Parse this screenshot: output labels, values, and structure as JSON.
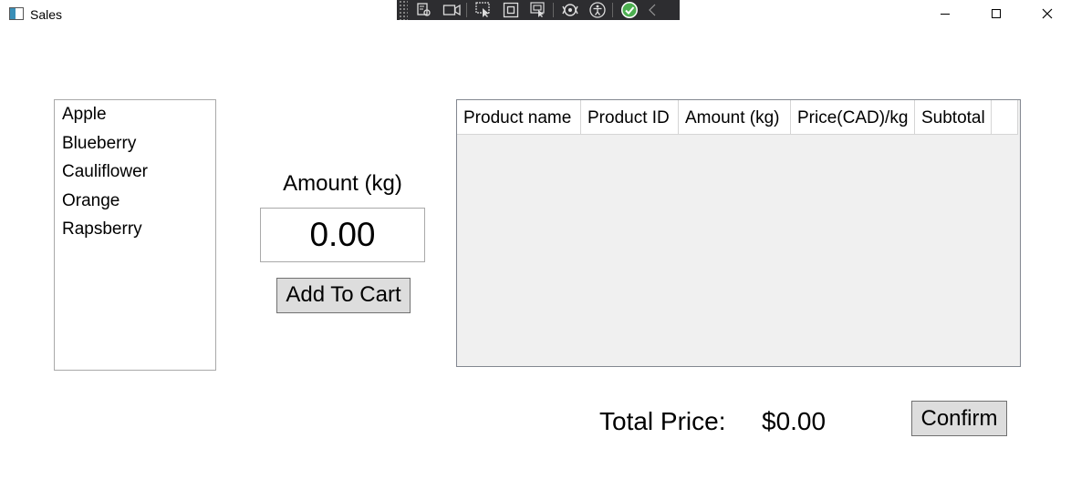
{
  "window": {
    "title": "Sales",
    "icons": [
      "app-window-icon",
      "minimize-icon",
      "maximize-icon",
      "close-icon"
    ]
  },
  "debug_toolbar": {
    "icons": [
      "live-visual-tree-icon",
      "record-icon",
      "select-element-icon",
      "display-layout-adorners-icon",
      "track-focus-icon",
      "hot-reload-icon",
      "accessibility-icon",
      "check-icon",
      "collapse-chevron-icon"
    ],
    "check_color": "#4caf50"
  },
  "products": {
    "items": [
      "Apple",
      "Blueberry",
      "Cauliflower",
      "Orange",
      "Rapsberry"
    ]
  },
  "amount": {
    "label": "Amount (kg)",
    "value": "0.00"
  },
  "add_button": {
    "label": "Add To Cart"
  },
  "cart": {
    "columns": [
      "Product name",
      "Product ID",
      "Amount (kg)",
      "Price(CAD)/kg",
      "Subtotal"
    ],
    "rows": []
  },
  "total": {
    "label": "Total Price:",
    "value": "$0.00"
  },
  "confirm_button": {
    "label": "Confirm"
  }
}
